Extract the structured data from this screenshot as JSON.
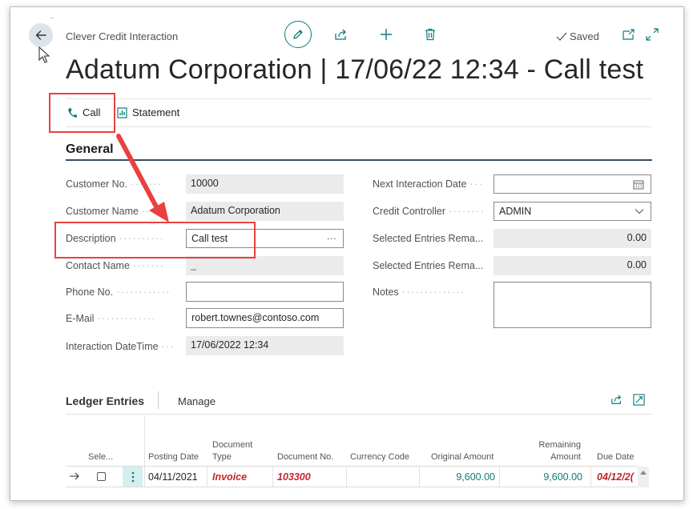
{
  "header": {
    "caption": "Clever Credit Interaction",
    "saved_label": "Saved",
    "title": "Adatum Corporation | 17/06/22 12:34 - Call test"
  },
  "actions": {
    "call_label": "Call",
    "statement_label": "Statement"
  },
  "general": {
    "section_title": "General",
    "left_fields": [
      {
        "label": "Customer No.",
        "value": "10000"
      },
      {
        "label": "Customer Name",
        "value": "Adatum Corporation"
      },
      {
        "label": "Description",
        "value": "Call test"
      },
      {
        "label": "Contact Name",
        "value": "_"
      },
      {
        "label": "Phone No.",
        "value": ""
      },
      {
        "label": "E-Mail",
        "value": "robert.townes@contoso.com"
      },
      {
        "label": "Interaction DateTime",
        "value": "17/06/2022 12:34"
      }
    ],
    "right_fields": [
      {
        "label": "Next Interaction Date",
        "value": ""
      },
      {
        "label": "Credit Controller",
        "value": "ADMIN"
      },
      {
        "label": "Selected Entries Rema...",
        "value": "0.00"
      },
      {
        "label": "Selected Entries Rema...",
        "value": "0.00"
      },
      {
        "label": "Notes",
        "value": ""
      }
    ],
    "ellipsis": "···"
  },
  "ledger": {
    "title": "Ledger Entries",
    "manage_label": "Manage",
    "columns": {
      "select": "Sele...",
      "posting_date": "Posting Date",
      "document_type": "Document Type",
      "document_no": "Document No.",
      "currency_code": "Currency Code",
      "original_amount": "Original Amount",
      "remaining_amount": "Remaining Amount",
      "due_date": "Due Date"
    },
    "rows": [
      {
        "posting_date": "04/11/2021",
        "document_type": "Invoice",
        "document_no": "103300",
        "currency_code": "",
        "original_amount": "9,600.00",
        "remaining_amount": "9,600.00",
        "due_date": "04/12/2("
      }
    ]
  },
  "colors": {
    "accent": "#0f7b7b",
    "annotation_red": "#e8413f",
    "overdue_red": "#c0262a"
  }
}
